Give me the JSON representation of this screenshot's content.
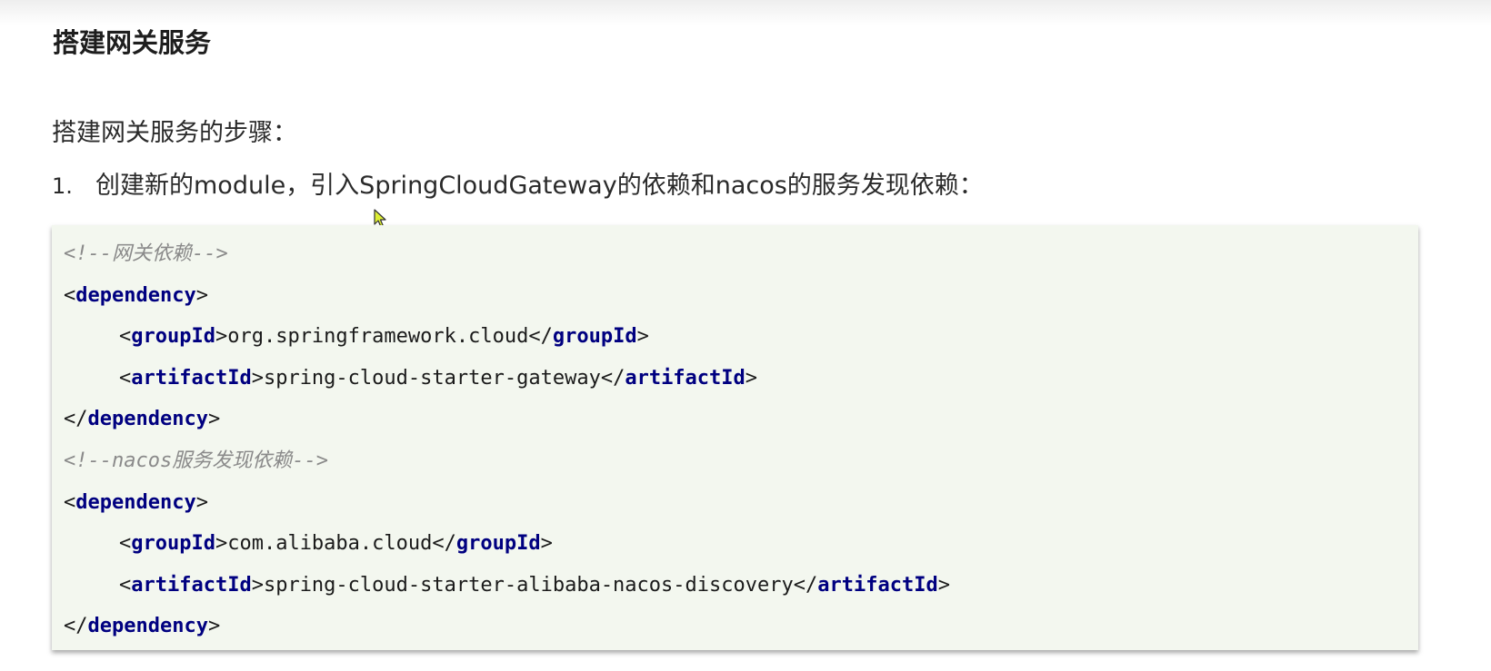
{
  "document": {
    "title": "搭建网关服务",
    "intro": "搭建网关服务的步骤：",
    "steps": [
      {
        "number": "1.",
        "text": "创建新的module，引入SpringCloudGateway的依赖和nacos的服务发现依赖："
      }
    ]
  },
  "code": {
    "comment1": "<!--网关依赖-->",
    "comment2": "<!--nacos服务发现依赖-->",
    "dep1": {
      "group_value": "org.springframework.cloud",
      "artifact_value": "spring-cloud-starter-gateway"
    },
    "dep2": {
      "group_value": "com.alibaba.cloud",
      "artifact_value": "spring-cloud-starter-alibaba-nacos-discovery"
    },
    "tags": {
      "dependency": "dependency",
      "groupId": "groupId",
      "artifactId": "artifactId"
    },
    "punct": {
      "lt": "<",
      "gt": ">",
      "lt_slash": "</"
    }
  },
  "icons": {
    "cursor": "mouse-pointer-icon"
  },
  "colors": {
    "code_background": "#f3f7ef",
    "xml_tag": "#000080",
    "xml_comment": "#8a8a8a"
  }
}
